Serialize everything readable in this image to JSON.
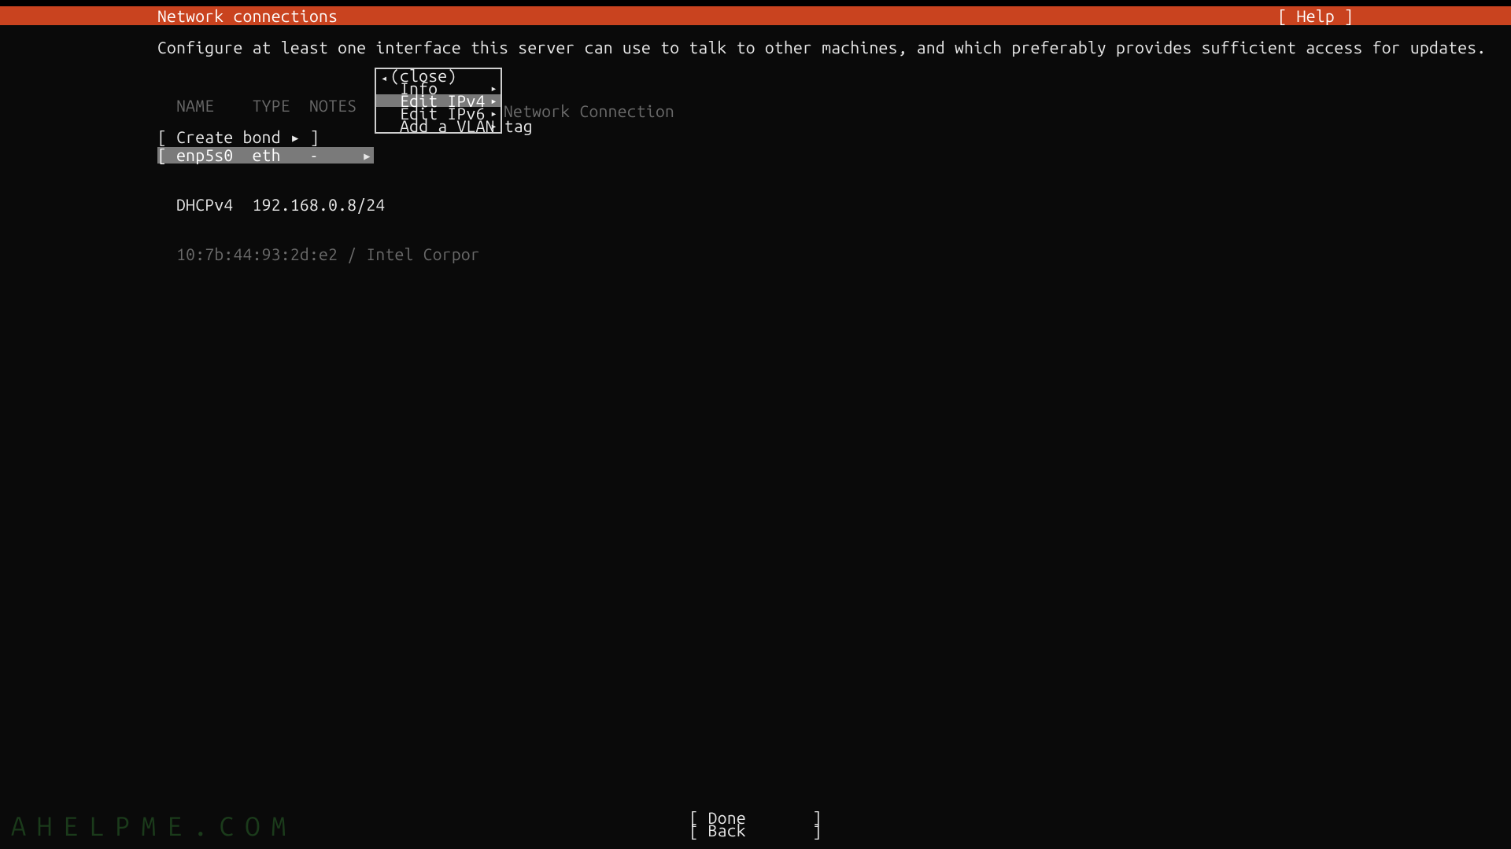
{
  "header": {
    "title": "Network connections",
    "help": "[ Help ]"
  },
  "instruction": "Configure at least one interface this server can use to talk to other machines, and which preferably provides sufficient access for updates.",
  "table": {
    "columns": {
      "name": "NAME",
      "type": "TYPE",
      "notes": "NOTES"
    },
    "rows": [
      {
        "bracket_l": "[",
        "name": "enp5s0",
        "type": "eth",
        "notes": "-",
        "arrow": "▸",
        "selected": true
      },
      {
        "name": "DHCPv4",
        "value": "192.168.0.8/24"
      },
      {
        "mac_vendor": "10:7b:44:93:2d:e2 / Intel Corpor",
        "tail": "Network Connection"
      }
    ]
  },
  "create_bond": "[ Create bond ▸ ]",
  "popup": {
    "items": [
      {
        "label": "(close)",
        "left_arrow": "◂"
      },
      {
        "label": "Info",
        "right_arrow": "▸"
      },
      {
        "label": "Edit IPv4",
        "right_arrow": "▸",
        "highlight": true
      },
      {
        "label": "Edit IPv6",
        "right_arrow": "▸"
      },
      {
        "label": "Add a VLAN tag",
        "right_arrow": "▸"
      }
    ]
  },
  "footer": {
    "done": "[ Done       ]",
    "back": "[ Back       ]"
  },
  "watermark": "AHELPME.COM"
}
